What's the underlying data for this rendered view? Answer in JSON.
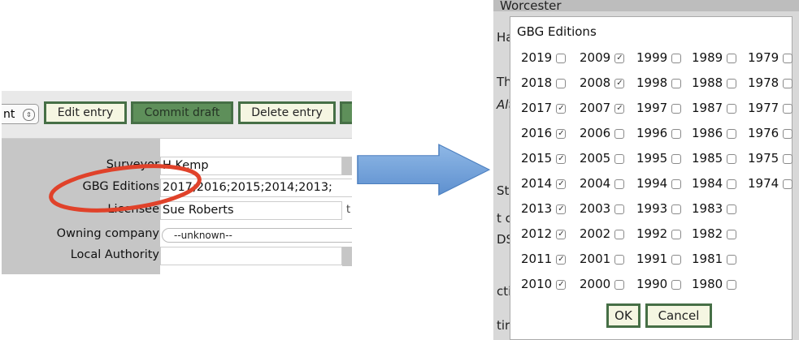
{
  "left_form": {
    "select_stub_text": "nt",
    "select_arrows_icon": "updown-chevron-icon",
    "buttons": {
      "edit": "Edit entry",
      "commit": "Commit draft",
      "delete": "Delete entry"
    },
    "fields": {
      "surveyor": {
        "label": "Surveyor",
        "value": "H Kemp"
      },
      "gbg_editions": {
        "label": "GBG Editions",
        "value": "2017;2016;2015;2014;2013;"
      },
      "licensee": {
        "label": "Licensee",
        "value": "Sue Roberts",
        "side_char": "t"
      },
      "owning_company": {
        "label": "Owning company",
        "value": "--unknown--"
      },
      "local_authority": {
        "label": "Local Authority",
        "value": ""
      }
    },
    "highlight_color": "#e0422a"
  },
  "annotation": {
    "arrow_color": "#6fa0d8",
    "arrow_icon": "right-arrow-icon"
  },
  "background_page": {
    "fragments": [
      "Worcester",
      "Ha",
      "Th",
      "Alt",
      "Str",
      "t c",
      "DS",
      "cti",
      "tir"
    ]
  },
  "dialog": {
    "title": "GBG Editions",
    "columns": [
      [
        {
          "year": "2019",
          "checked": false
        },
        {
          "year": "2018",
          "checked": false
        },
        {
          "year": "2017",
          "checked": true
        },
        {
          "year": "2016",
          "checked": true
        },
        {
          "year": "2015",
          "checked": true
        },
        {
          "year": "2014",
          "checked": true
        },
        {
          "year": "2013",
          "checked": true
        },
        {
          "year": "2012",
          "checked": true
        },
        {
          "year": "2011",
          "checked": true
        },
        {
          "year": "2010",
          "checked": true
        }
      ],
      [
        {
          "year": "2009",
          "checked": true
        },
        {
          "year": "2008",
          "checked": true
        },
        {
          "year": "2007",
          "checked": true
        },
        {
          "year": "2006",
          "checked": false
        },
        {
          "year": "2005",
          "checked": false
        },
        {
          "year": "2004",
          "checked": false
        },
        {
          "year": "2003",
          "checked": false
        },
        {
          "year": "2002",
          "checked": false
        },
        {
          "year": "2001",
          "checked": false
        },
        {
          "year": "2000",
          "checked": false
        }
      ],
      [
        {
          "year": "1999",
          "checked": false
        },
        {
          "year": "1998",
          "checked": false
        },
        {
          "year": "1997",
          "checked": false
        },
        {
          "year": "1996",
          "checked": false
        },
        {
          "year": "1995",
          "checked": false
        },
        {
          "year": "1994",
          "checked": false
        },
        {
          "year": "1993",
          "checked": false
        },
        {
          "year": "1992",
          "checked": false
        },
        {
          "year": "1991",
          "checked": false
        },
        {
          "year": "1990",
          "checked": false
        }
      ],
      [
        {
          "year": "1989",
          "checked": false
        },
        {
          "year": "1988",
          "checked": false
        },
        {
          "year": "1987",
          "checked": false
        },
        {
          "year": "1986",
          "checked": false
        },
        {
          "year": "1985",
          "checked": false
        },
        {
          "year": "1984",
          "checked": false
        },
        {
          "year": "1983",
          "checked": false
        },
        {
          "year": "1982",
          "checked": false
        },
        {
          "year": "1981",
          "checked": false
        },
        {
          "year": "1980",
          "checked": false
        }
      ],
      [
        {
          "year": "1979",
          "checked": false
        },
        {
          "year": "1978",
          "checked": false
        },
        {
          "year": "1977",
          "checked": false
        },
        {
          "year": "1976",
          "checked": false
        },
        {
          "year": "1975",
          "checked": false
        },
        {
          "year": "1974",
          "checked": false
        }
      ]
    ],
    "ok_label": "OK",
    "cancel_label": "Cancel"
  },
  "colors": {
    "button_border": "#466f46",
    "button_fill": "#f5f6e2",
    "button_dark_fill": "#5e8f5a",
    "form_grey": "#c6c6c6"
  }
}
